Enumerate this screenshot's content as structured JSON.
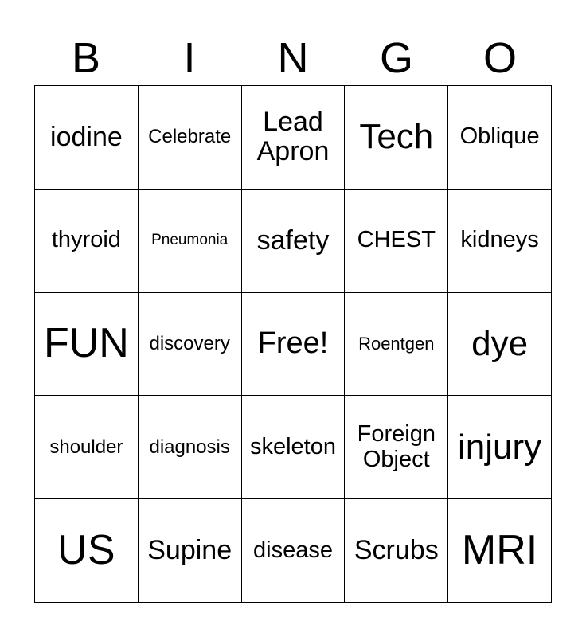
{
  "header": [
    "B",
    "I",
    "N",
    "G",
    "O"
  ],
  "cells": [
    [
      "iodine",
      "Celebrate",
      "Lead Apron",
      "Tech",
      "Oblique"
    ],
    [
      "thyroid",
      "Pneumonia",
      "safety",
      "CHEST",
      "kidneys"
    ],
    [
      "FUN",
      "discovery",
      "Free!",
      "Roentgen",
      "dye"
    ],
    [
      "shoulder",
      "diagnosis",
      "skeleton",
      "Foreign Object",
      "injury"
    ],
    [
      "US",
      "Supine",
      "disease",
      "Scrubs",
      "MRI"
    ]
  ]
}
